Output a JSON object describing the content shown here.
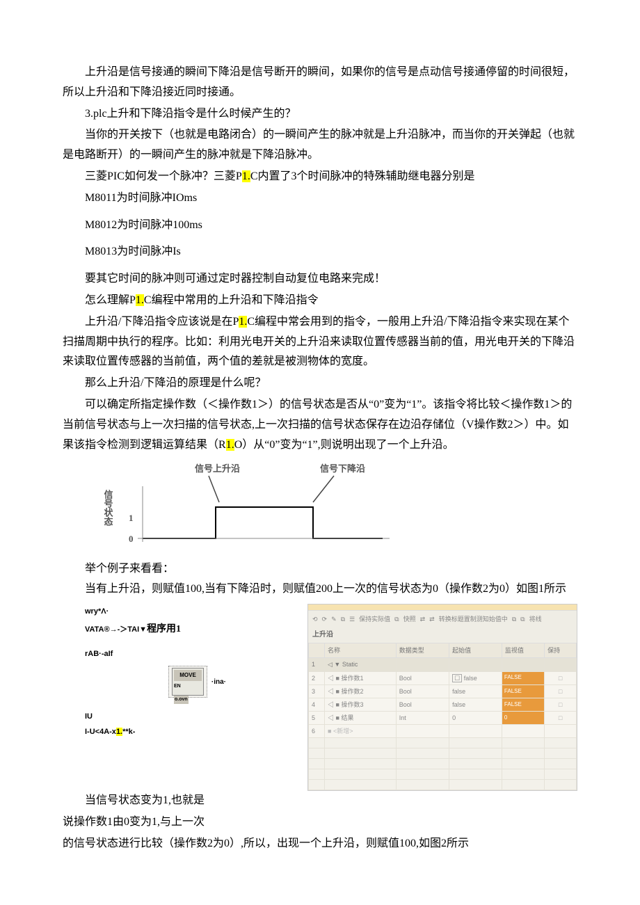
{
  "paragraphs": {
    "p1": "上升沿是信号接通的瞬间下降沿是信号断开的瞬间，如果你的信号是点动信号接通停留的时间很短，所以上升沿和下降沿接近同时接通。",
    "p2": "3.plc上升和下降沿指令是什么时候产生的？",
    "p3": "当你的开关按下（也就是电路闭合）的一瞬间产生的脉冲就是上升沿脉冲，而当你的开关弹起（也就是电路断开）的一瞬间产生的脉冲就是下降沿脉冲。",
    "p4a": "三菱PIC如何发一个脉冲？三菱P",
    "p4hl": "1.",
    "p4b": "C内置了3个时间脉冲的特殊辅助继电器分别是",
    "p5": "M8011为时间脉冲IOms",
    "p6": "M8012为时间脉冲100ms",
    "p7": "M8013为时间脉冲Is",
    "p8": "要其它时间的脉冲则可通过定时器控制自动复位电路来完成！",
    "p9a": "怎么理解P",
    "p9hl": "1.",
    "p9b": "C编程中常用的上升沿和下降沿指令",
    "p10a": "上升沿/下降沿指令应该说是在P",
    "p10hl": "1.",
    "p10b": "C编程中常会用到的指令，一般用上升沿/下降沿指令来实现在某个扫描周期中执行的程序。比如：利用光电开关的上升沿来读取位置传感器当前的值，用光电开关的下降沿来读取位置传感器的当前值，两个值的差就是被测物体的宽度。",
    "p11": "那么上升沿/下降沿的原理是什么呢？",
    "p12a": "可以确定所指定操作数（＜操作数1＞）的信号状态是否从“0”变为“1”。该指令将比较＜操作数1＞的当前信号状态与上一次扫描的信号状态,上一次扫描的信号状态保存在边沿存储位（V操作数2＞）中。如果该指令检测到逻辑运算结果（R",
    "p12hl": "1.",
    "p12b": "O）从“0”变为“1”,则说明出现了一个上升沿。"
  },
  "diagram": {
    "rising": "信号上升沿",
    "falling": "信号下降沿",
    "ylabel": "信号状态",
    "y1": "1",
    "y0": "0"
  },
  "example": {
    "l1": "举个例子来看看：",
    "l2": "当有上升沿，则赋值100,当有下降沿时，则赋值200上一次的信号状态为0（操作数2为0）如图1所示",
    "code1": "wry*Λ·",
    "code2a": "VATA®→-＞TAI",
    "code2b": "▼",
    "code2c": "程序用1",
    "code3": "rAB·-aIf",
    "code4": "·ina·",
    "code5a": "o.ovn",
    "mov": "MOVE",
    "mov_en": "EN",
    "code6": "IU",
    "code7a": "I-U<4A-x",
    "code7hl": "1.",
    "code7b": "**k-"
  },
  "table": {
    "toolbar_text": "转换标题置制测知始值中",
    "toolbar_left1": "保持实际值",
    "toolbar_left2": "快照",
    "title": "上升沿",
    "headers": {
      "name": "名称",
      "type": "数据类型",
      "start": "起始值",
      "monitor": "监视值",
      "keep": "保持"
    },
    "rows": [
      {
        "name": "Static",
        "type": "",
        "start": "",
        "monitor": "",
        "keep": ""
      },
      {
        "name": "操作数1",
        "type": "Bool",
        "start": "false",
        "monitor": "FALSE",
        "keep": "□"
      },
      {
        "name": "操作数2",
        "type": "Bool",
        "start": "false",
        "monitor": "FALSE",
        "keep": "□"
      },
      {
        "name": "操作数3",
        "type": "Bool",
        "start": "false",
        "monitor": "FALSE",
        "keep": "□"
      },
      {
        "name": "结果",
        "type": "Int",
        "start": "0",
        "monitor": "0",
        "keep": "□"
      },
      {
        "name": "<新增>",
        "type": "",
        "start": "",
        "monitor": "",
        "keep": ""
      }
    ]
  },
  "after": {
    "p1": "当信号状态变为1,也就是",
    "p2": "说操作数1由0变为1,与上一次",
    "p3": "的信号状态进行比较（操作数2为0）,所以，出现一个上升沿，则赋值100,如图2所示"
  }
}
